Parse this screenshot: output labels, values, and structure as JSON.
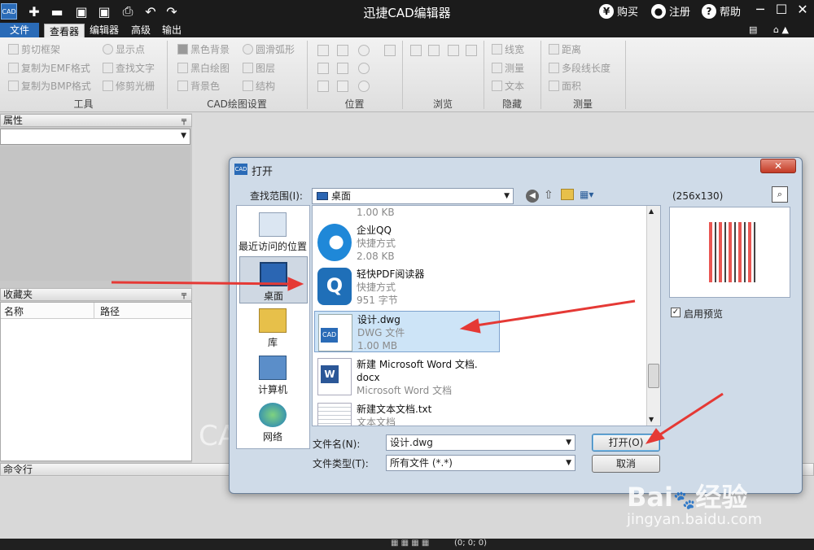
{
  "app": {
    "title": "迅捷CAD编辑器",
    "logo_text": "CAD"
  },
  "topbar": {
    "buy": "购买",
    "register": "注册",
    "help": "帮助",
    "buy_icon": "¥",
    "register_icon": "●",
    "help_icon": "?"
  },
  "menu": {
    "file": "文件",
    "viewer": "查看器",
    "editor": "编辑器",
    "advanced": "高级",
    "output": "输出"
  },
  "ribbon": {
    "tools": {
      "label": "工具",
      "items": [
        "剪切框架",
        "复制为EMF格式",
        "复制为BMP格式",
        "显示点",
        "查找文字",
        "修剪光栅"
      ]
    },
    "cad_settings": {
      "label": "CAD绘图设置",
      "items": [
        "黑色背景",
        "黑白绘图",
        "背景色",
        "圆滑弧形",
        "图层",
        "结构"
      ]
    },
    "position": {
      "label": "位置"
    },
    "browse": {
      "label": "浏览"
    },
    "hide": {
      "label": "隐藏",
      "items": [
        "线宽",
        "测量",
        "文本"
      ]
    },
    "measure": {
      "label": "测量",
      "items": [
        "距离",
        "多段线长度",
        "面积"
      ]
    }
  },
  "panels": {
    "properties": {
      "title": "属性"
    },
    "favorites": {
      "title": "收藏夹",
      "col_name": "名称",
      "col_path": "路径"
    },
    "command": {
      "title": "命令行"
    },
    "status_coords": "(0; 0; 0)",
    "watermark": "CA"
  },
  "dialog": {
    "title": "打开",
    "title_icon": "CAD",
    "lookin_label": "查找范围(I):",
    "lookin_value": "桌面",
    "preview_size": "(256x130)",
    "enable_preview": "启用预览",
    "filename_label": "文件名(N):",
    "filename_value": "设计.dwg",
    "filetype_label": "文件类型(T):",
    "filetype_value": "所有文件 (*.*)",
    "open_button": "打开(O)",
    "cancel_button": "取消",
    "places": [
      "最近访问的位置",
      "桌面",
      "库",
      "计算机",
      "网络"
    ],
    "files": [
      {
        "name": "",
        "type": "",
        "size": "1.00 KB"
      },
      {
        "name": "企业QQ",
        "type": "快捷方式",
        "size": "2.08 KB"
      },
      {
        "name": "轻快PDF阅读器",
        "type": "快捷方式",
        "size": "951 字节"
      },
      {
        "name": "设计.dwg",
        "type": "DWG 文件",
        "size": "1.00 MB"
      },
      {
        "name": "新建 Microsoft Word 文档.",
        "name2": "docx",
        "type": "Microsoft Word 文档",
        "size": ""
      },
      {
        "name": "新建文本文档.txt",
        "type": "文本文档",
        "size": ""
      }
    ]
  },
  "watermark": {
    "brand": "Bai",
    "brand_cn": "经验",
    "url": "jingyan.baidu.com"
  },
  "colors": {
    "titlebar": "#1b1b1b",
    "accent": "#2a6bb7",
    "arrow": "#e53935",
    "selection": "#cde4f7"
  }
}
